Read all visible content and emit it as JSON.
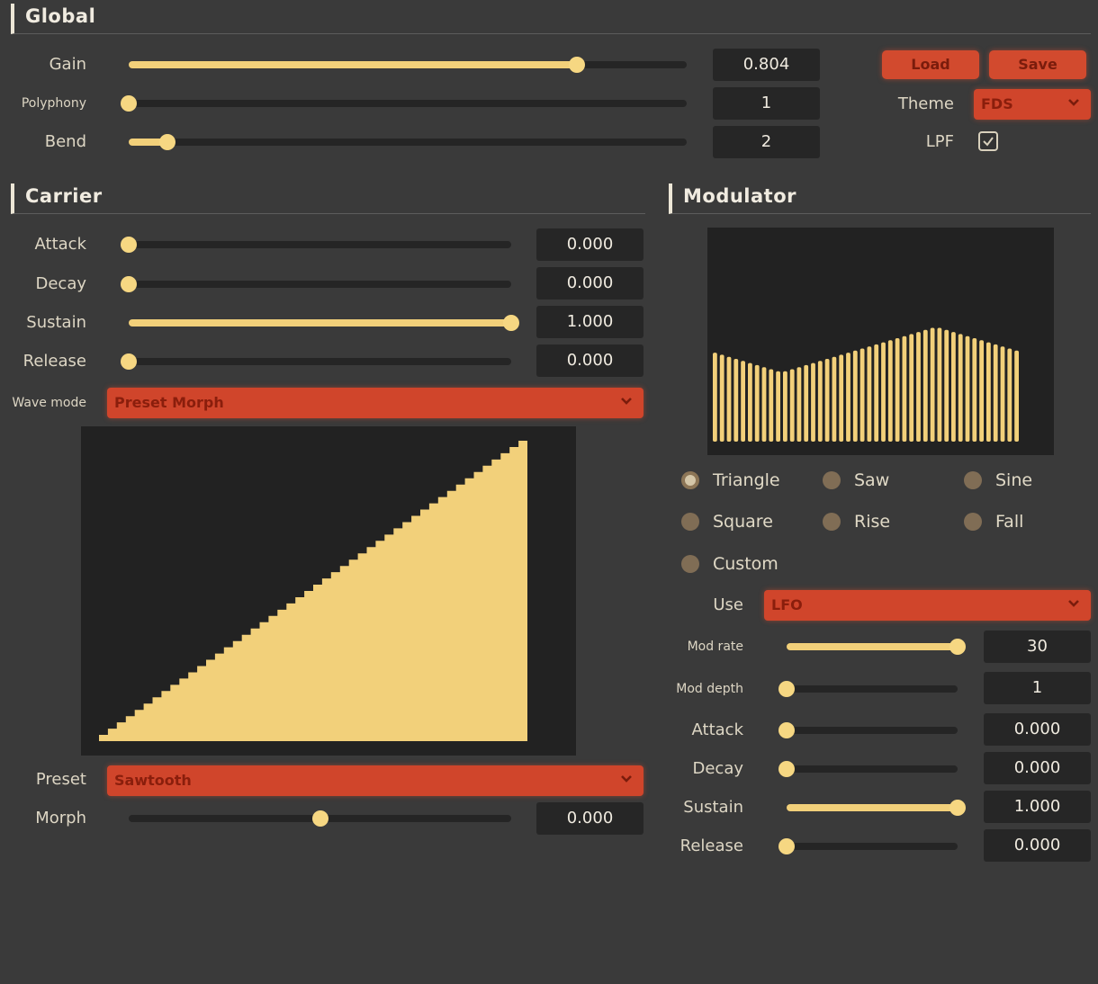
{
  "global": {
    "title": "Global",
    "gain": {
      "label": "Gain",
      "value": "0.804",
      "level": 0.804
    },
    "polyphony": {
      "label": "Polyphony",
      "value": "1",
      "level": 0.0
    },
    "bend": {
      "label": "Bend",
      "value": "2",
      "level": 0.07
    },
    "load_label": "Load",
    "save_label": "Save",
    "theme_label": "Theme",
    "theme_value": "FDS",
    "lpf_label": "LPF",
    "lpf_checked": true
  },
  "carrier": {
    "title": "Carrier",
    "attack": {
      "label": "Attack",
      "value": "0.000",
      "level": 0.0
    },
    "decay": {
      "label": "Decay",
      "value": "0.000",
      "level": 0.0
    },
    "sustain": {
      "label": "Sustain",
      "value": "1.000",
      "level": 1.0
    },
    "release": {
      "label": "Release",
      "value": "0.000",
      "level": 0.0
    },
    "wave_mode_label": "Wave mode",
    "wave_mode_value": "Preset Morph",
    "preset_label": "Preset",
    "preset_value": "Sawtooth",
    "morph": {
      "label": "Morph",
      "value": "0.000",
      "level": 0.5
    }
  },
  "modulator": {
    "title": "Modulator",
    "waveforms": [
      "Triangle",
      "Saw",
      "Sine",
      "Square",
      "Rise",
      "Fall",
      "Custom"
    ],
    "selected_waveform": "Triangle",
    "use_label": "Use",
    "use_value": "LFO",
    "mod_rate": {
      "label": "Mod rate",
      "value": "30",
      "level": 1.0
    },
    "mod_depth": {
      "label": "Mod depth",
      "value": "1",
      "level": 0.0
    },
    "attack": {
      "label": "Attack",
      "value": "0.000",
      "level": 0.0
    },
    "decay": {
      "label": "Decay",
      "value": "0.000",
      "level": 0.0
    },
    "sustain": {
      "label": "Sustain",
      "value": "1.000",
      "level": 1.0
    },
    "release": {
      "label": "Release",
      "value": "0.000",
      "level": 0.0
    },
    "bars": [
      0.86,
      0.84,
      0.82,
      0.8,
      0.78,
      0.76,
      0.74,
      0.72,
      0.7,
      0.68,
      0.68,
      0.7,
      0.72,
      0.74,
      0.76,
      0.78,
      0.8,
      0.82,
      0.84,
      0.86,
      0.88,
      0.9,
      0.92,
      0.94,
      0.96,
      0.98,
      1.0,
      1.02,
      1.04,
      1.06,
      1.08,
      1.1,
      1.1,
      1.08,
      1.06,
      1.04,
      1.02,
      1.0,
      0.98,
      0.96,
      0.94,
      0.92,
      0.9,
      0.88
    ]
  },
  "colors": {
    "accent": "#d24a2e",
    "fill": "#f2d07a",
    "background": "#3a3a3a",
    "panel": "#222222"
  }
}
